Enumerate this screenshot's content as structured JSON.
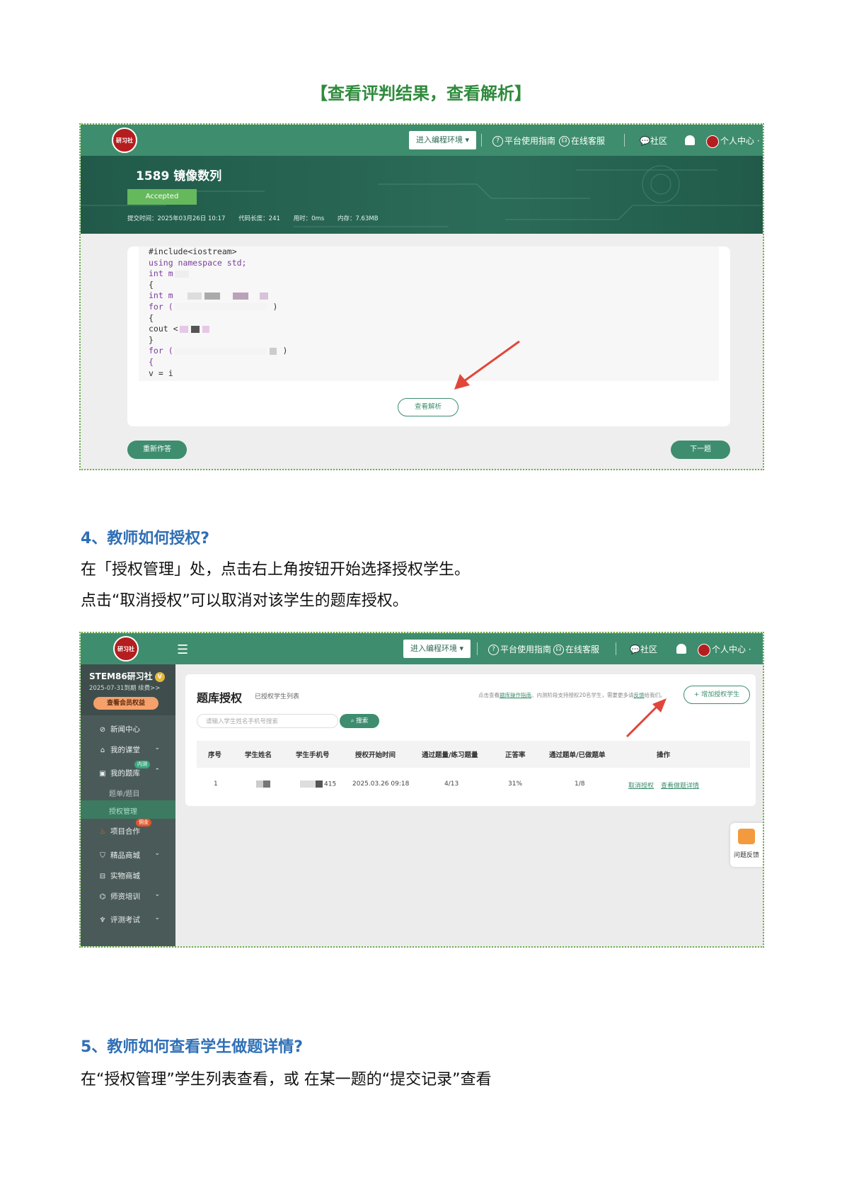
{
  "heading": "【查看评判结果，查看解析】",
  "shot1": {
    "logo_text": "研习社",
    "enter_env": "进入编程环境",
    "nav": {
      "guide": "平台使用指南",
      "service": "在线客服",
      "community": "社区",
      "user_center": "个人中心"
    },
    "problem_title": "1589 镜像数列",
    "status": "Accepted",
    "meta": {
      "submit_time": "提交时间：2025年03月26日 10:17",
      "code_length": "代码长度：241",
      "time_used": "用时：0ms",
      "memory": "内存：7.63MB"
    },
    "code_lines": [
      "#include<iostream>",
      "using namespace std;",
      "int m",
      "{",
      "int m",
      "for (",
      "{",
      "cout <",
      "}",
      "for (",
      "{",
      "v = i"
    ],
    "view_analysis": "查看解析",
    "retry": "重新作答",
    "next": "下一题"
  },
  "section4": {
    "title": "4、教师如何授权?",
    "line1": "在「授权管理」处，点击右上角按钮开始选择授权学生。",
    "line2": "点击“取消授权”可以取消对该学生的题库授权。"
  },
  "shot2": {
    "logo_text": "研习社",
    "enter_env": "进入编程环境",
    "nav": {
      "guide": "平台使用指南",
      "service": "在线客服",
      "community": "社区",
      "user_center": "个人中心"
    },
    "sidebar": {
      "brand": "STEM86研习社",
      "expire": "2025-07-31到期 续费>>",
      "member_btn": "查看会员权益",
      "items": [
        {
          "label": "新闻中心"
        },
        {
          "label": "我的课堂"
        },
        {
          "label": "我的题库",
          "tag": "内测"
        },
        {
          "label": "项目合作",
          "tag": "佣金"
        },
        {
          "label": "精品商城"
        },
        {
          "label": "实物商城"
        },
        {
          "label": "师资培训"
        },
        {
          "label": "评测考试"
        }
      ],
      "sub_items": [
        "题单/题目",
        "授权管理"
      ]
    },
    "card": {
      "title": "题库授权",
      "subtitle": "已授权学生列表",
      "note_prefix": "点击查看",
      "note_link": "题库操作指南",
      "note_mid": "。内测阶段支持授权20名学生，需要更多请",
      "note_link2": "反馈",
      "note_suffix": "给我们。",
      "add_btn": "+ 增加授权学生",
      "search_placeholder": "请输入学生姓名手机号搜索",
      "search_btn": "搜索",
      "columns": [
        "序号",
        "学生姓名",
        "学生手机号",
        "授权开始时间",
        "通过题量/练习题量",
        "正答率",
        "通过题单/已做题单",
        "操作"
      ],
      "row": {
        "index": "1",
        "phone_suffix": "415",
        "start": "2025.03.26 09:18",
        "passed": "4/13",
        "rate": "31%",
        "lists": "1/8",
        "cancel": "取消授权",
        "detail": "查看做题详情"
      }
    },
    "feedback": "问题反馈"
  },
  "section5": {
    "title": "5、教师如何查看学生做题详情?",
    "line1": "在“授权管理”学生列表查看，或 在某一题的“提交记录”查看"
  },
  "colors": {
    "brand_green": "#3e8d6e",
    "heading_green": "#2f8a3d",
    "heading_blue": "#2f6fb6",
    "arrow_red": "#e0473a"
  }
}
